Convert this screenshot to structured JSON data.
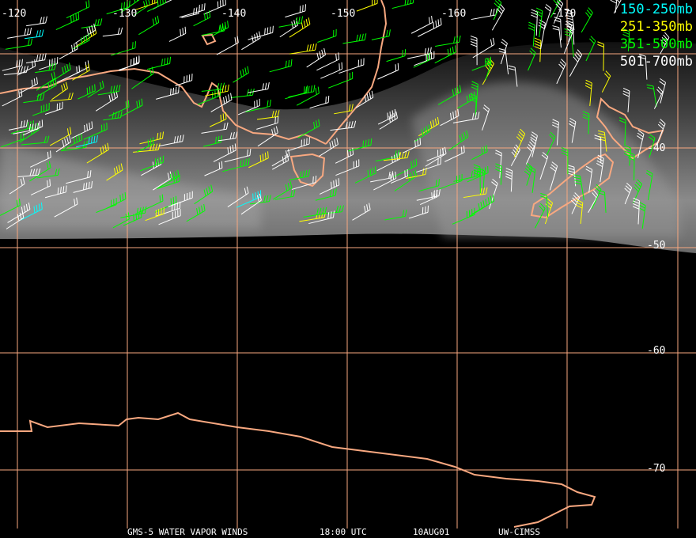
{
  "legend": [
    {
      "label": "150-250mb",
      "color": "#00ffff"
    },
    {
      "label": "251-350mb",
      "color": "#ffff00"
    },
    {
      "label": "351-500mb",
      "color": "#00ff00"
    },
    {
      "label": "501-700mb",
      "color": "#ffffff"
    }
  ],
  "longitude_labels": [
    "-120",
    "-130",
    "-140",
    "-150",
    "-160",
    "-170"
  ],
  "latitude_labels": [
    "-40",
    "-50",
    "-60",
    "-70"
  ],
  "footer": {
    "satellite": "GMS-5 WATER VAPOR WINDS",
    "time": "18:00 UTC",
    "date": "10AUG01",
    "source": "UW-CIMSS"
  },
  "colors": {
    "grid": "#f8a880",
    "coast": "#f8a880"
  }
}
